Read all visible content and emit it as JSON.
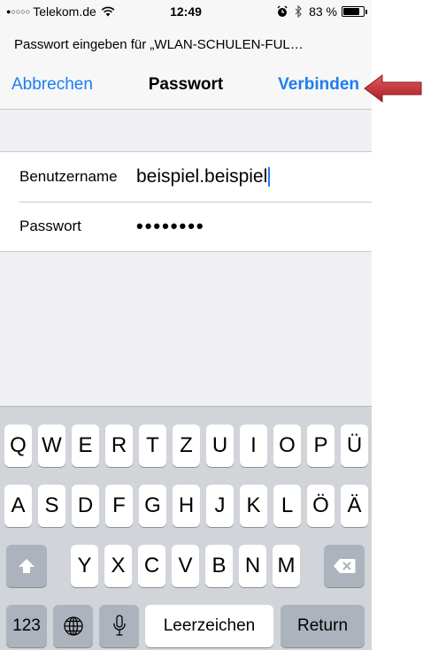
{
  "status_bar": {
    "signal": "●○○○○",
    "carrier": "Telekom.de",
    "time": "12:49",
    "battery_percent": "83 %",
    "battery_level": 0.83,
    "icons": [
      "wifi-icon",
      "alarm-icon",
      "bluetooth-icon",
      "battery-icon"
    ]
  },
  "dialog": {
    "prompt": "Passwort eingeben für „WLAN-SCHULEN-FUL…",
    "cancel_label": "Abbrechen",
    "title": "Passwort",
    "connect_label": "Verbinden"
  },
  "form": {
    "username_label": "Benutzername",
    "username_value": "beispiel.beispiel",
    "password_label": "Passwort",
    "password_value": "••••••••"
  },
  "keyboard": {
    "row1": [
      "Q",
      "W",
      "E",
      "R",
      "T",
      "Z",
      "U",
      "I",
      "O",
      "P",
      "Ü"
    ],
    "row2": [
      "A",
      "S",
      "D",
      "F",
      "G",
      "H",
      "J",
      "K",
      "L",
      "Ö",
      "Ä"
    ],
    "row3": [
      "Y",
      "X",
      "C",
      "V",
      "B",
      "N",
      "M"
    ],
    "numbers_label": "123",
    "space_label": "Leerzeichen",
    "return_label": "Return"
  },
  "colors": {
    "accent": "#1d7cf2",
    "arrow": "#c0282d"
  }
}
